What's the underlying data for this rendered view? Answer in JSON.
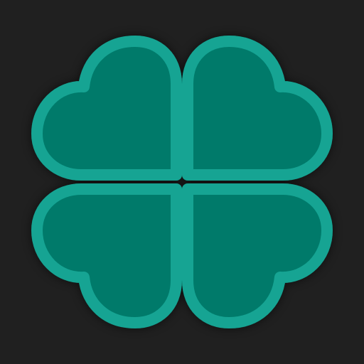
{
  "icon": {
    "name": "four-leaf-clover-icon",
    "leaves": [
      "top-left",
      "top-right",
      "bottom-left",
      "bottom-right"
    ]
  },
  "colors": {
    "background": "#202020",
    "leaf_fill": "#007A6A",
    "leaf_outline": "#13A493"
  }
}
